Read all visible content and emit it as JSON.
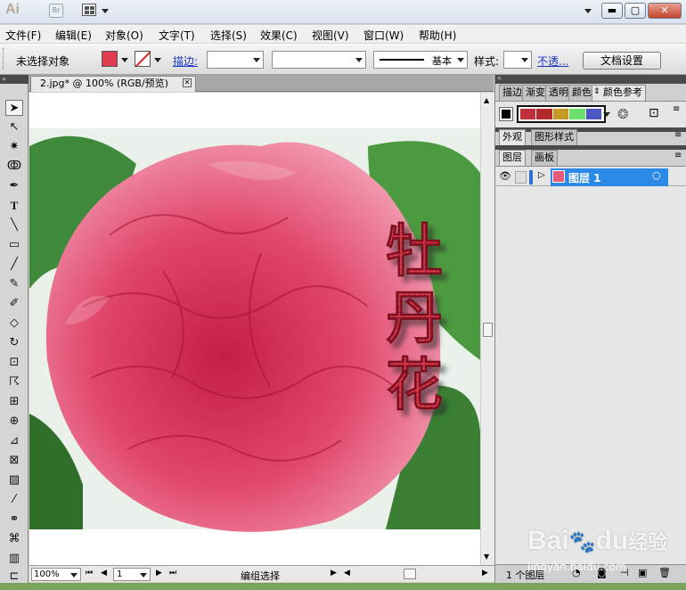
{
  "app": {
    "logo": "Ai",
    "bridge": "Br"
  },
  "window": {
    "minimize": "▬",
    "restore": "▢",
    "close": "✕"
  },
  "menu": [
    "文件(F)",
    "编辑(E)",
    "对象(O)",
    "文字(T)",
    "选择(S)",
    "效果(C)",
    "视图(V)",
    "窗口(W)",
    "帮助(H)"
  ],
  "control": {
    "selection_status": "未选择对象",
    "stroke_label": "描边:",
    "stroke_style_label": "基本",
    "style_label": "样式:",
    "opacity_label": "不透...",
    "doc_settings": "文档设置"
  },
  "document": {
    "tab_title": "2.jpg* @ 100% (RGB/预览)",
    "artwork_text": [
      "牡",
      "丹",
      "花"
    ]
  },
  "colors": {
    "fill": "#e23a4e",
    "accent_blue": "#2b6fd6",
    "flower": "#e85a7a",
    "leaf": "#3f8a3a"
  },
  "panels": {
    "top_tabs": [
      "描边",
      "渐变",
      "透明",
      "颜色",
      "颜色参考"
    ],
    "swatches": [
      "#c0303c",
      "#b22a2a",
      "#c59a25",
      "#6be06b",
      "#4a56c2"
    ],
    "mid_tabs": [
      "外观",
      "图形样式"
    ],
    "layer_tabs": [
      "图层",
      "画板"
    ],
    "layer_name": "图层 1",
    "layer_count": "1 个图层"
  },
  "status": {
    "zoom": "100%",
    "page": "1",
    "mode": "编组选择"
  },
  "watermark": {
    "brand": "Bai",
    "brand2": "du",
    "brand_cn": "经验",
    "url": "jingyan.baidu.com"
  }
}
